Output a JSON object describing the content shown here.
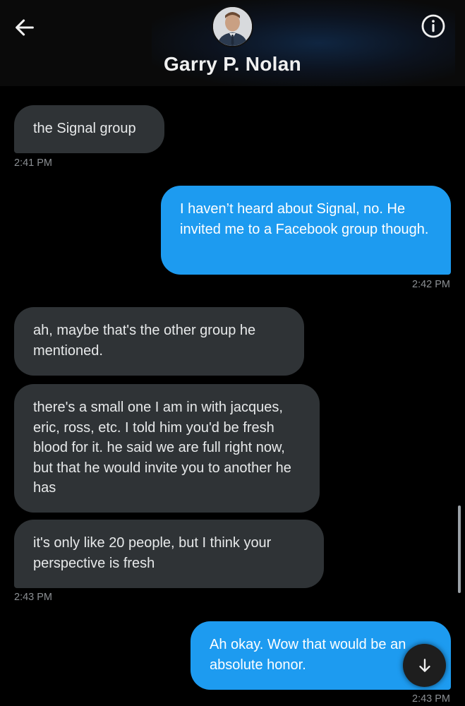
{
  "header": {
    "contact_name": "Garry P. Nolan",
    "back_icon": "arrow-left-icon",
    "info_icon": "info-circle-icon"
  },
  "messages": [
    {
      "direction": "incoming",
      "text": "the Signal group",
      "time": "2:41 PM"
    },
    {
      "direction": "outgoing",
      "text": "I haven’t heard about Signal, no. He invited me to a Facebook group though.",
      "time": "2:42 PM"
    },
    {
      "direction": "incoming",
      "text": "ah, maybe that's the other group he mentioned."
    },
    {
      "direction": "incoming",
      "text": "there's a small one I am in with jacques, eric, ross, etc.  I told him you'd be fresh blood for it.  he said we are full right now, but that he would invite you to another he has"
    },
    {
      "direction": "incoming",
      "text": "it's only like 20 people, but I think your perspective is fresh",
      "time": "2:43 PM"
    },
    {
      "direction": "outgoing",
      "text": "Ah okay. Wow that would be an absolute honor.",
      "time": "2:43 PM"
    }
  ],
  "scroll_down_icon": "arrow-down-icon",
  "colors": {
    "incoming_bubble": "#2f3336",
    "outgoing_bubble": "#1d9bf0",
    "background": "#000000",
    "timestamp": "#8b8f93"
  }
}
